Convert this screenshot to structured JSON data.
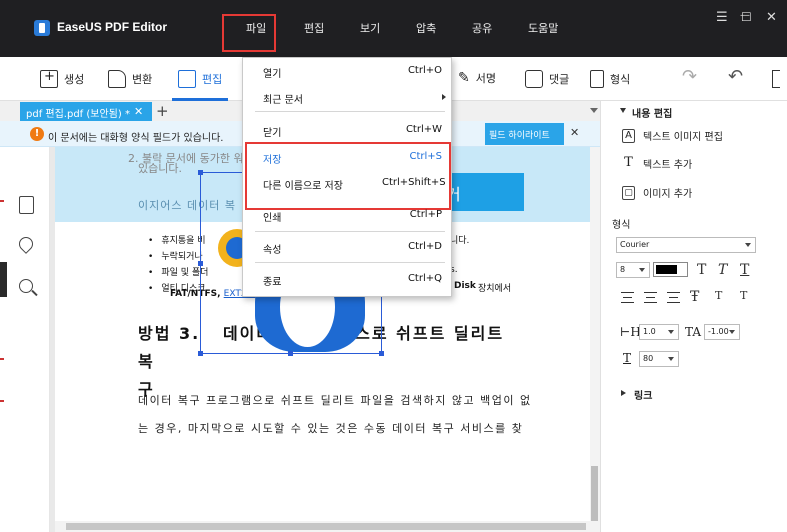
{
  "app": {
    "title": "EaseUS PDF Editor"
  },
  "menu": [
    "파일",
    "편집",
    "보기",
    "압축",
    "공유",
    "도움말"
  ],
  "window_controls": [
    "☰",
    "—",
    "☐",
    "✕"
  ],
  "toolbar": {
    "tools": [
      {
        "label": "생성",
        "icon": "plus-square-icon"
      },
      {
        "label": "변환",
        "icon": "convert-icon"
      },
      {
        "label": "편집",
        "icon": "pen-icon"
      },
      {
        "label": "서명",
        "icon": "sign-pen-icon"
      },
      {
        "label": "댓글",
        "icon": "comment-icon"
      },
      {
        "label": "형식",
        "icon": "form-icon"
      }
    ],
    "redo": "↷",
    "undo": "↶"
  },
  "tab": {
    "name": "pdf 편집.pdf (보안됨) *",
    "close": "✕",
    "add": "+"
  },
  "notice": {
    "icon": "!",
    "text": "이 문서에는 대화형 양식 필드가 있습니다.",
    "highlight_button": "필드 하이라이트",
    "close": "✕"
  },
  "document": {
    "line1": "2. 불락 문서에 동가한 워라나",
    "line2": "있습니다.",
    "small_heading": "이지어스 데이터 복",
    "blue_button": "거",
    "bullets": [
      "휴지통을 비",
      "누락되거나",
      "파일 및 폴더",
      "얼티 디스크"
    ],
    "bullet1_right": "니다.",
    "bullet3_right": "s.",
    "bullet4_bold": "Disk",
    "bullet4_right": "장치에서",
    "fat_line": "FAT/NTFS,",
    "fat_link": "EXT2/E",
    "heading_part1": "방법 3.",
    "heading_part2": "데이터 복구 서비스로 쉬프트 딜리트 복",
    "heading_part3": "구",
    "para1": "데이터 복구 프로그램으로 쉬프트 딜리트 파일을 검색하지 않고 백업이 없",
    "para2": "는 경우, 마지막으로 시도할 수 있는 것은 수동 데이터 복구 서비스를 찾"
  },
  "right_panel": {
    "section_title": "내용 편집",
    "items": [
      "텍스트 이미지 편집",
      "텍스트 추가",
      "이미지 추가"
    ],
    "item_icons": [
      "A",
      "T",
      "▢"
    ],
    "format_label": "형식",
    "font": "Courier",
    "size": "8",
    "text_styles": [
      "T",
      "T",
      "T"
    ],
    "align_styles": [
      "Ŧ",
      "T",
      "T"
    ],
    "line_spacing": "1.0",
    "char_spacing": "-1.00",
    "scale": "80",
    "link_label": "링크"
  },
  "file_menu": {
    "items": [
      {
        "label": "열기",
        "shortcut": "Ctrl+O"
      },
      {
        "label": "최근 문서",
        "shortcut": ""
      },
      {
        "label": "닫기",
        "shortcut": "Ctrl+W"
      },
      {
        "label": "저장",
        "shortcut": "Ctrl+S"
      },
      {
        "label": "다른 이름으로 저장",
        "shortcut": "Ctrl+Shift+S"
      },
      {
        "label": "인쇄",
        "shortcut": "Ctrl+P"
      },
      {
        "label": "속성",
        "shortcut": "Ctrl+D"
      },
      {
        "label": "종료",
        "shortcut": "Ctrl+Q"
      }
    ]
  },
  "colors": {
    "accent": "#1e6fd9",
    "highlight_red": "#e53935",
    "tab_blue": "#2aa4e8",
    "title_bg": "#1f1f22"
  }
}
